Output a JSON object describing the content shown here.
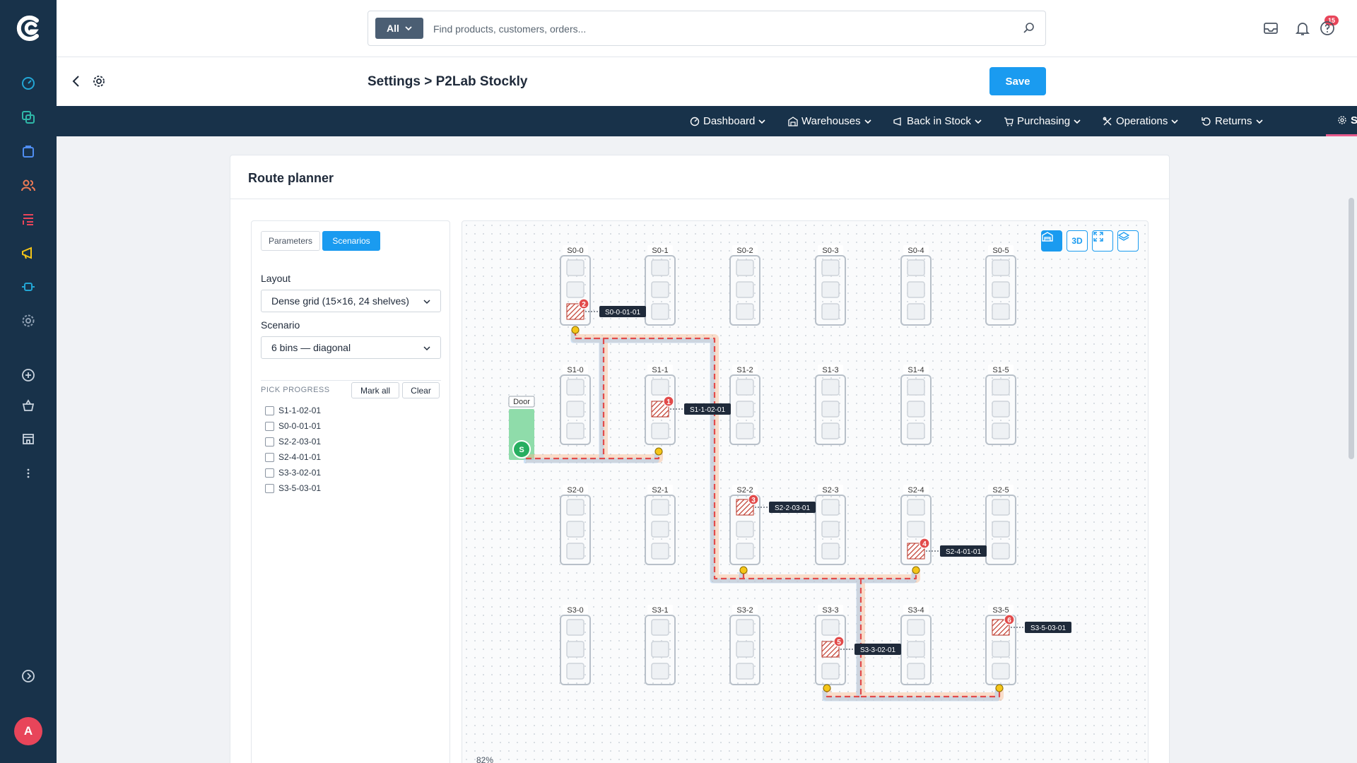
{
  "search": {
    "scope": "All",
    "placeholder": "Find products, customers, orders..."
  },
  "notifications": {
    "inbox_count": "15"
  },
  "header": {
    "breadcrumb": "Settings > P2Lab Stockly",
    "save_label": "Save"
  },
  "nav": {
    "items": [
      {
        "label": "Dashboard",
        "icon": "dashboard-icon"
      },
      {
        "label": "Warehouses",
        "icon": "warehouse-icon"
      },
      {
        "label": "Back in Stock",
        "icon": "megaphone-icon"
      },
      {
        "label": "Purchasing",
        "icon": "cart-icon"
      },
      {
        "label": "Operations",
        "icon": "tools-icon"
      },
      {
        "label": "Returns",
        "icon": "returns-icon"
      },
      {
        "label": "Settings",
        "icon": "gear-icon",
        "active": true
      }
    ]
  },
  "card": {
    "title": "Route planner"
  },
  "panel": {
    "tabs": {
      "parameters": "Parameters",
      "scenarios": "Scenarios",
      "active": "Scenarios"
    },
    "layout_label": "Layout",
    "layout_value": "Dense grid (15×16, 24 shelves)",
    "scenario_label": "Scenario",
    "scenario_value": "6 bins — diagonal",
    "progress_title": "PICK PROGRESS",
    "mark_all": "Mark all",
    "clear": "Clear",
    "picks": [
      {
        "label": "S1-1-02-01",
        "checked": false
      },
      {
        "label": "S0-0-01-01",
        "checked": false
      },
      {
        "label": "S2-2-03-01",
        "checked": false
      },
      {
        "label": "S2-4-01-01",
        "checked": false
      },
      {
        "label": "S3-3-02-01",
        "checked": false
      },
      {
        "label": "S3-5-03-01",
        "checked": false
      }
    ]
  },
  "map": {
    "toolbar": {
      "warehouse": "warehouse-icon",
      "three_d": "3D",
      "fullscreen": "expand-icon",
      "layers": "layers-icon"
    },
    "door_label": "Door",
    "start_label": "S",
    "zoom": "82%",
    "shelves": [
      "S0-0",
      "S0-1",
      "S0-2",
      "S0-3",
      "S0-4",
      "S0-5",
      "S1-0",
      "S1-1",
      "S1-2",
      "S1-3",
      "S1-4",
      "S1-5",
      "S2-0",
      "S2-1",
      "S2-2",
      "S2-3",
      "S2-4",
      "S2-5",
      "S3-0",
      "S3-1",
      "S3-2",
      "S3-3",
      "S3-4",
      "S3-5"
    ],
    "stops": [
      {
        "order": "1",
        "bin": "S1-1-02-01",
        "shelf": "S1-1",
        "slot": 2
      },
      {
        "order": "2",
        "bin": "S0-0-01-01",
        "shelf": "S0-0",
        "slot": 3
      },
      {
        "order": "3",
        "bin": "S2-2-03-01",
        "shelf": "S2-2",
        "slot": 1
      },
      {
        "order": "4",
        "bin": "S2-4-01-01",
        "shelf": "S2-4",
        "slot": 3
      },
      {
        "order": "5",
        "bin": "S3-3-02-01",
        "shelf": "S3-3",
        "slot": 2
      },
      {
        "order": "6",
        "bin": "S3-5-03-01",
        "shelf": "S3-5",
        "slot": 1
      }
    ],
    "colors": {
      "route": "#e24b4b",
      "route_halo_a": "#f8b98f",
      "route_halo_b": "#a9cdf0",
      "door": "#8fdcaa",
      "start": "#27ae60",
      "waypoint": "#f5c518",
      "stop_badge": "#e24b4b"
    }
  }
}
